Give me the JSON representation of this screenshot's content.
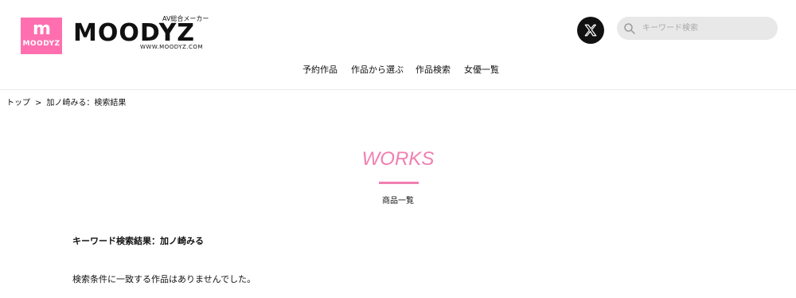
{
  "header": {
    "logo": {
      "box_letter": "m",
      "box_word": "MOODYZ",
      "tagline": "AV総合メーカー",
      "wordmark": "MOODYZ",
      "url": "WWW.MOODYZ.COM"
    },
    "social_icon": "x-logo-icon",
    "search": {
      "placeholder": "キーワード検索",
      "value": "",
      "icon": "search-icon"
    },
    "nav": [
      {
        "label": "予約作品"
      },
      {
        "label": "作品から選ぶ"
      },
      {
        "label": "作品検索"
      },
      {
        "label": "女優一覧"
      }
    ]
  },
  "breadcrumb": {
    "home": "トップ",
    "separator": ">",
    "current": "加ノ崎みる：検索結果"
  },
  "section": {
    "title": "WORKS",
    "subtitle": "商品一覧"
  },
  "results": {
    "heading": "キーワード検索結果：加ノ崎みる",
    "empty_message": "検索条件に一致する作品はありませんでした。"
  },
  "colors": {
    "brand_pink": "#ff6fb0",
    "accent_pink": "#f080b0",
    "search_bg": "#e8e8e8"
  }
}
